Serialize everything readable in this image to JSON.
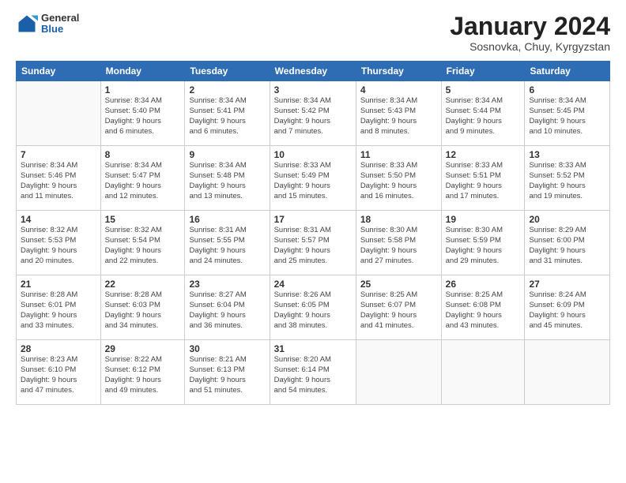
{
  "header": {
    "logo_general": "General",
    "logo_blue": "Blue",
    "month_title": "January 2024",
    "subtitle": "Sosnovka, Chuy, Kyrgyzstan"
  },
  "weekdays": [
    "Sunday",
    "Monday",
    "Tuesday",
    "Wednesday",
    "Thursday",
    "Friday",
    "Saturday"
  ],
  "weeks": [
    [
      {
        "day": "",
        "info": ""
      },
      {
        "day": "1",
        "info": "Sunrise: 8:34 AM\nSunset: 5:40 PM\nDaylight: 9 hours\nand 6 minutes."
      },
      {
        "day": "2",
        "info": "Sunrise: 8:34 AM\nSunset: 5:41 PM\nDaylight: 9 hours\nand 6 minutes."
      },
      {
        "day": "3",
        "info": "Sunrise: 8:34 AM\nSunset: 5:42 PM\nDaylight: 9 hours\nand 7 minutes."
      },
      {
        "day": "4",
        "info": "Sunrise: 8:34 AM\nSunset: 5:43 PM\nDaylight: 9 hours\nand 8 minutes."
      },
      {
        "day": "5",
        "info": "Sunrise: 8:34 AM\nSunset: 5:44 PM\nDaylight: 9 hours\nand 9 minutes."
      },
      {
        "day": "6",
        "info": "Sunrise: 8:34 AM\nSunset: 5:45 PM\nDaylight: 9 hours\nand 10 minutes."
      }
    ],
    [
      {
        "day": "7",
        "info": "Sunrise: 8:34 AM\nSunset: 5:46 PM\nDaylight: 9 hours\nand 11 minutes."
      },
      {
        "day": "8",
        "info": "Sunrise: 8:34 AM\nSunset: 5:47 PM\nDaylight: 9 hours\nand 12 minutes."
      },
      {
        "day": "9",
        "info": "Sunrise: 8:34 AM\nSunset: 5:48 PM\nDaylight: 9 hours\nand 13 minutes."
      },
      {
        "day": "10",
        "info": "Sunrise: 8:33 AM\nSunset: 5:49 PM\nDaylight: 9 hours\nand 15 minutes."
      },
      {
        "day": "11",
        "info": "Sunrise: 8:33 AM\nSunset: 5:50 PM\nDaylight: 9 hours\nand 16 minutes."
      },
      {
        "day": "12",
        "info": "Sunrise: 8:33 AM\nSunset: 5:51 PM\nDaylight: 9 hours\nand 17 minutes."
      },
      {
        "day": "13",
        "info": "Sunrise: 8:33 AM\nSunset: 5:52 PM\nDaylight: 9 hours\nand 19 minutes."
      }
    ],
    [
      {
        "day": "14",
        "info": "Sunrise: 8:32 AM\nSunset: 5:53 PM\nDaylight: 9 hours\nand 20 minutes."
      },
      {
        "day": "15",
        "info": "Sunrise: 8:32 AM\nSunset: 5:54 PM\nDaylight: 9 hours\nand 22 minutes."
      },
      {
        "day": "16",
        "info": "Sunrise: 8:31 AM\nSunset: 5:55 PM\nDaylight: 9 hours\nand 24 minutes."
      },
      {
        "day": "17",
        "info": "Sunrise: 8:31 AM\nSunset: 5:57 PM\nDaylight: 9 hours\nand 25 minutes."
      },
      {
        "day": "18",
        "info": "Sunrise: 8:30 AM\nSunset: 5:58 PM\nDaylight: 9 hours\nand 27 minutes."
      },
      {
        "day": "19",
        "info": "Sunrise: 8:30 AM\nSunset: 5:59 PM\nDaylight: 9 hours\nand 29 minutes."
      },
      {
        "day": "20",
        "info": "Sunrise: 8:29 AM\nSunset: 6:00 PM\nDaylight: 9 hours\nand 31 minutes."
      }
    ],
    [
      {
        "day": "21",
        "info": "Sunrise: 8:28 AM\nSunset: 6:01 PM\nDaylight: 9 hours\nand 33 minutes."
      },
      {
        "day": "22",
        "info": "Sunrise: 8:28 AM\nSunset: 6:03 PM\nDaylight: 9 hours\nand 34 minutes."
      },
      {
        "day": "23",
        "info": "Sunrise: 8:27 AM\nSunset: 6:04 PM\nDaylight: 9 hours\nand 36 minutes."
      },
      {
        "day": "24",
        "info": "Sunrise: 8:26 AM\nSunset: 6:05 PM\nDaylight: 9 hours\nand 38 minutes."
      },
      {
        "day": "25",
        "info": "Sunrise: 8:25 AM\nSunset: 6:07 PM\nDaylight: 9 hours\nand 41 minutes."
      },
      {
        "day": "26",
        "info": "Sunrise: 8:25 AM\nSunset: 6:08 PM\nDaylight: 9 hours\nand 43 minutes."
      },
      {
        "day": "27",
        "info": "Sunrise: 8:24 AM\nSunset: 6:09 PM\nDaylight: 9 hours\nand 45 minutes."
      }
    ],
    [
      {
        "day": "28",
        "info": "Sunrise: 8:23 AM\nSunset: 6:10 PM\nDaylight: 9 hours\nand 47 minutes."
      },
      {
        "day": "29",
        "info": "Sunrise: 8:22 AM\nSunset: 6:12 PM\nDaylight: 9 hours\nand 49 minutes."
      },
      {
        "day": "30",
        "info": "Sunrise: 8:21 AM\nSunset: 6:13 PM\nDaylight: 9 hours\nand 51 minutes."
      },
      {
        "day": "31",
        "info": "Sunrise: 8:20 AM\nSunset: 6:14 PM\nDaylight: 9 hours\nand 54 minutes."
      },
      {
        "day": "",
        "info": ""
      },
      {
        "day": "",
        "info": ""
      },
      {
        "day": "",
        "info": ""
      }
    ]
  ]
}
